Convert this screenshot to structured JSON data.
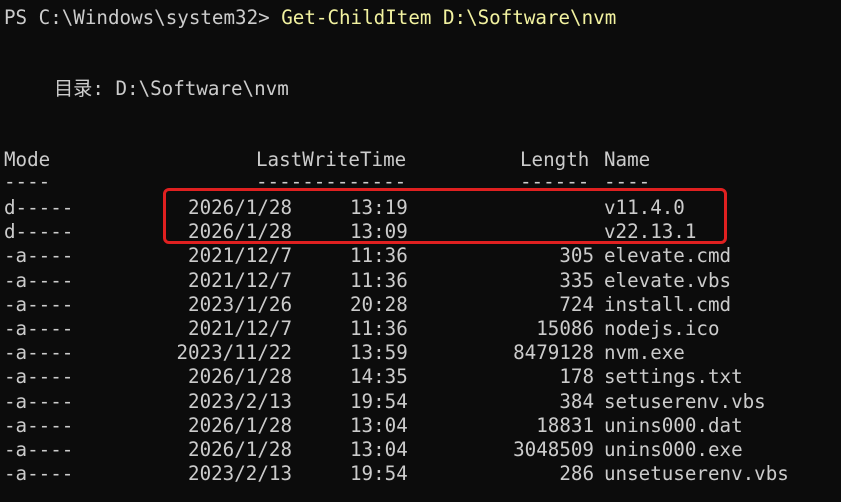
{
  "console": {
    "partial_line": "                                                        ",
    "prompt": "PS C:\\Windows\\system32> ",
    "command": "Get-ChildItem D:\\Software\\nvm",
    "directory_line": "目录: D:\\Software\\nvm",
    "headers": {
      "mode": "Mode",
      "last_write_time": "LastWriteTime",
      "length": "Length",
      "name": "Name"
    },
    "separators": {
      "mode": "----",
      "last_write_time": "-------------",
      "length": "------",
      "name": "----"
    },
    "rows": [
      {
        "mode": "d-----",
        "date": "2026/1/28",
        "time": "13:19",
        "length": "",
        "name": "v11.4.0"
      },
      {
        "mode": "d-----",
        "date": "2026/1/28",
        "time": "13:09",
        "length": "",
        "name": "v22.13.1"
      },
      {
        "mode": "-a----",
        "date": "2021/12/7",
        "time": "11:36",
        "length": "305",
        "name": "elevate.cmd"
      },
      {
        "mode": "-a----",
        "date": "2021/12/7",
        "time": "11:36",
        "length": "335",
        "name": "elevate.vbs"
      },
      {
        "mode": "-a----",
        "date": "2023/1/26",
        "time": "20:28",
        "length": "724",
        "name": "install.cmd"
      },
      {
        "mode": "-a----",
        "date": "2021/12/7",
        "time": "11:36",
        "length": "15086",
        "name": "nodejs.ico"
      },
      {
        "mode": "-a----",
        "date": "2023/11/22",
        "time": "13:59",
        "length": "8479128",
        "name": "nvm.exe"
      },
      {
        "mode": "-a----",
        "date": "2026/1/28",
        "time": "14:35",
        "length": "178",
        "name": "settings.txt"
      },
      {
        "mode": "-a----",
        "date": "2023/2/13",
        "time": "19:54",
        "length": "384",
        "name": "setuserenv.vbs"
      },
      {
        "mode": "-a----",
        "date": "2026/1/28",
        "time": "13:04",
        "length": "18831",
        "name": "unins000.dat"
      },
      {
        "mode": "-a----",
        "date": "2026/1/28",
        "time": "13:04",
        "length": "3048509",
        "name": "unins000.exe"
      },
      {
        "mode": "-a----",
        "date": "2023/2/13",
        "time": "19:54",
        "length": "286",
        "name": "unsetuserenv.vbs"
      }
    ]
  },
  "colors": {
    "background": "#0c0c0c",
    "text": "#cccccc",
    "command": "#f2f2a0",
    "highlight_border": "#e02020"
  }
}
